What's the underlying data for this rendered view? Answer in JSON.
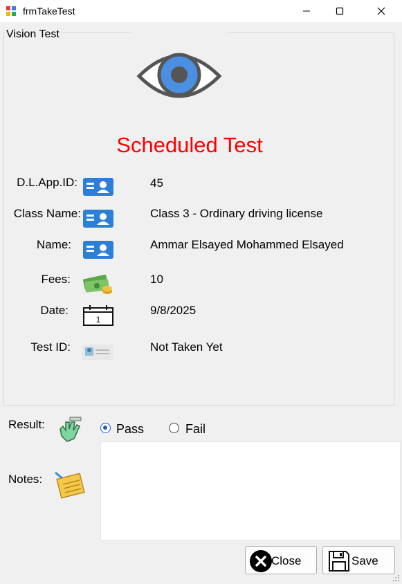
{
  "window": {
    "title": "frmTakeTest"
  },
  "group": {
    "title": "Vision Test"
  },
  "heading": "Scheduled Test",
  "fields": {
    "app_id": {
      "label": "D.L.App.ID:",
      "value": "45"
    },
    "class_name": {
      "label": "Class Name:",
      "value": "Class 3 - Ordinary driving license"
    },
    "name": {
      "label": "Name:",
      "value": "Ammar Elsayed Mohammed Elsayed"
    },
    "fees": {
      "label": "Fees:",
      "value": "10"
    },
    "date": {
      "label": "Date:",
      "value": "9/8/2025",
      "calendar_day": "1"
    },
    "test_id": {
      "label": "Test ID:",
      "value": "Not Taken Yet"
    }
  },
  "result": {
    "label": "Result:",
    "pass_label": "Pass",
    "fail_label": "Fail",
    "selected": "Pass"
  },
  "notes": {
    "label": "Notes:",
    "value": ""
  },
  "buttons": {
    "close_label": "Close",
    "save_label": "Save"
  },
  "colors": {
    "heading": "#ff0000",
    "card_icon": "#2b7fd6",
    "radio_accent": "#1c5bc9"
  }
}
